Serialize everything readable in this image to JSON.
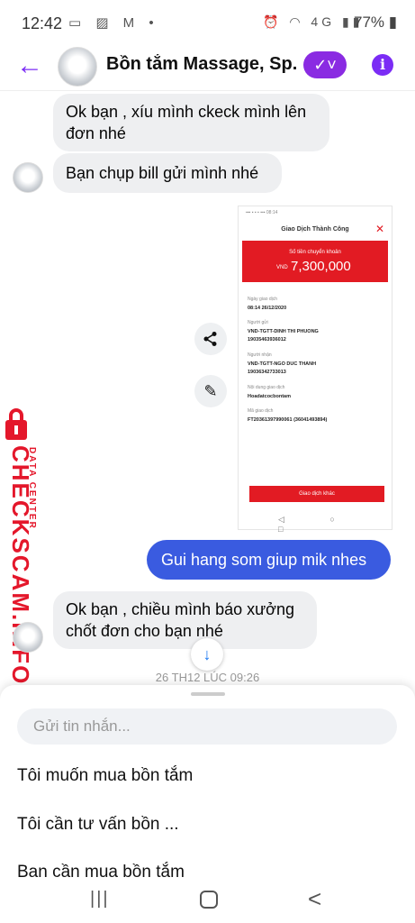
{
  "status_bar": {
    "time": "12:42",
    "left_icons": "▭ ▨ M •",
    "right_icons": "⏰ ◠ 4G ▮▮",
    "battery": "77% ▮"
  },
  "header": {
    "back_icon": "←",
    "title": "Bồn tắm Massage, Sp...",
    "check_icon": "✓˅",
    "info_icon": "i",
    "accent": "#7b2cf5"
  },
  "messages": [
    {
      "dir": "in",
      "text": "Ok bạn , xíu mình ckeck mình lên đơn nhé"
    },
    {
      "dir": "in",
      "text": "Bạn chụp bill gửi mình nhé"
    },
    {
      "dir": "out",
      "text": "Gui hang som giup mik nhes"
    },
    {
      "dir": "in",
      "text": "Ok bạn , chiều mình báo xưởng chốt đơn cho bạn nhé"
    }
  ],
  "receipt": {
    "status_line": "▪▪▪ ▪ ▪ ▪                    ▪▪▪ 08:14",
    "title": "Giao Dịch Thành Công",
    "close_icon": "✕",
    "amount_label": "Số tiền chuyển khoản",
    "currency": "VND",
    "amount": "7,300,000",
    "fields": [
      {
        "label": "Ngày giao dịch",
        "value": "08:14 26/12/2020"
      },
      {
        "label": "Người gửi",
        "value": "VND-TGTT-DINH THI PHUONG",
        "value2": "19035463936012"
      },
      {
        "label": "Người nhận",
        "value": "VND-TGTT-NGO DUC THANH",
        "value2": "19036342733013"
      },
      {
        "label": "Nội dung giao dịch",
        "value": "Hoadatcocbontam"
      },
      {
        "label": "Mã giao dịch",
        "value": "FT20361397990061 (36041493894)"
      }
    ],
    "button": "Giao dịch khác",
    "nav": "◁ ○ □",
    "brand_red": "#e21b23"
  },
  "actions": {
    "share_icon": "⋖",
    "edit_icon": "✎"
  },
  "watermark": {
    "main": "CHECKSCAM.INFO",
    "sub": "DATA CENTER",
    "color": "#e4172b"
  },
  "scroll_icon": "↓",
  "timestamp": "26 TH12 LÚC 09:26",
  "composer": {
    "placeholder": "Gửi tin nhắn..."
  },
  "suggestions": [
    "Tôi muốn mua bồn tắm",
    "Tôi cần tư vấn bồn ...",
    "Bạn cần mua bồn tắm"
  ],
  "nav_bar": {
    "recent": "|||",
    "back": "<"
  },
  "colors": {
    "outgoing_bubble": "#3a5be0",
    "incoming_bubble": "#eeeff1"
  }
}
